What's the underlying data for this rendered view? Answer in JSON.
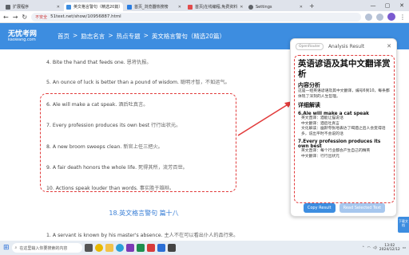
{
  "browser": {
    "tabs": [
      {
        "label": "扩展程序",
        "color": "#5f6368"
      },
      {
        "label": "英文格言警句（精选20篇）",
        "color": "#3d8de0"
      },
      {
        "label": "首页_浏览器热搜榜",
        "color": "#2a7de1"
      },
      {
        "label": "首页|在线编程,免费资料",
        "color": "#e24b4b"
      },
      {
        "label": "Settings",
        "color": "#5f6368"
      }
    ],
    "url": "51test.net/show/10956887.html",
    "not_secure": "不安全"
  },
  "site": {
    "logo_line1": "无忧考网",
    "logo_line2": "kaowang.com",
    "breadcrumb": [
      "首页",
      "励志名言",
      "热点专题",
      "英文格言警句（精选20篇）"
    ]
  },
  "article": {
    "lines": [
      {
        "en": "4. Bite the hand that feeds one.",
        "zh": "恩将仇报。"
      },
      {
        "en": "5. An ounce of luck is better than a pound of wisdom.",
        "zh": "聪明才智，不如运气。"
      },
      {
        "en": "6. Ale will make a cat speak.",
        "zh": "酒后吐真言。"
      },
      {
        "en": "7. Every profession produces its own best",
        "zh": "行行出状元。"
      },
      {
        "en": "8. A new broom sweeps clean.",
        "zh": "新官上任三把火。"
      },
      {
        "en": "9. A fair death honors the whole life.",
        "zh": "死得其所，流芳百世。"
      },
      {
        "en": "10. Actions speak louder than words.",
        "zh": "事实胜于雄辩。"
      }
    ],
    "section_heading": "18.英文格言警句 篇十八",
    "bottom_line": {
      "en": "1. A servant is known by his master's absence.",
      "zh": "主人不在可以看出仆人的品行来。"
    }
  },
  "panel": {
    "badge": "OpenRouter",
    "title": "Analysis Result",
    "h1": "英语谚语及其中文翻译赏析",
    "section1_title": "内容分析",
    "section1_text": "这是一组英语谚语及其中文翻译，编号6到10，每条都体现了深刻的人生哲理。",
    "section2_title": "详细解读",
    "items": [
      {
        "title": "6.Ale will make a cat speak",
        "lines": [
          "英文直译：酒能让猫说话",
          "中文翻译：酒后吐真言",
          "文化解读：幽默夸张地表达了喝酒之后人会变得话多，说出平时不会说的话"
        ]
      },
      {
        "title": "7.Every profession produces its own best",
        "lines": [
          "英文直译：每个行业都会产生自己的精英",
          "中文翻译：行行出状元"
        ]
      }
    ],
    "copy_button": "Copy Result",
    "read_button": "Read Selected Text"
  },
  "fab_label": "下载文档",
  "taskbar": {
    "search_placeholder": "在这里输入你要搜索的内容",
    "time": "13:02",
    "date": "2024/12/12"
  }
}
